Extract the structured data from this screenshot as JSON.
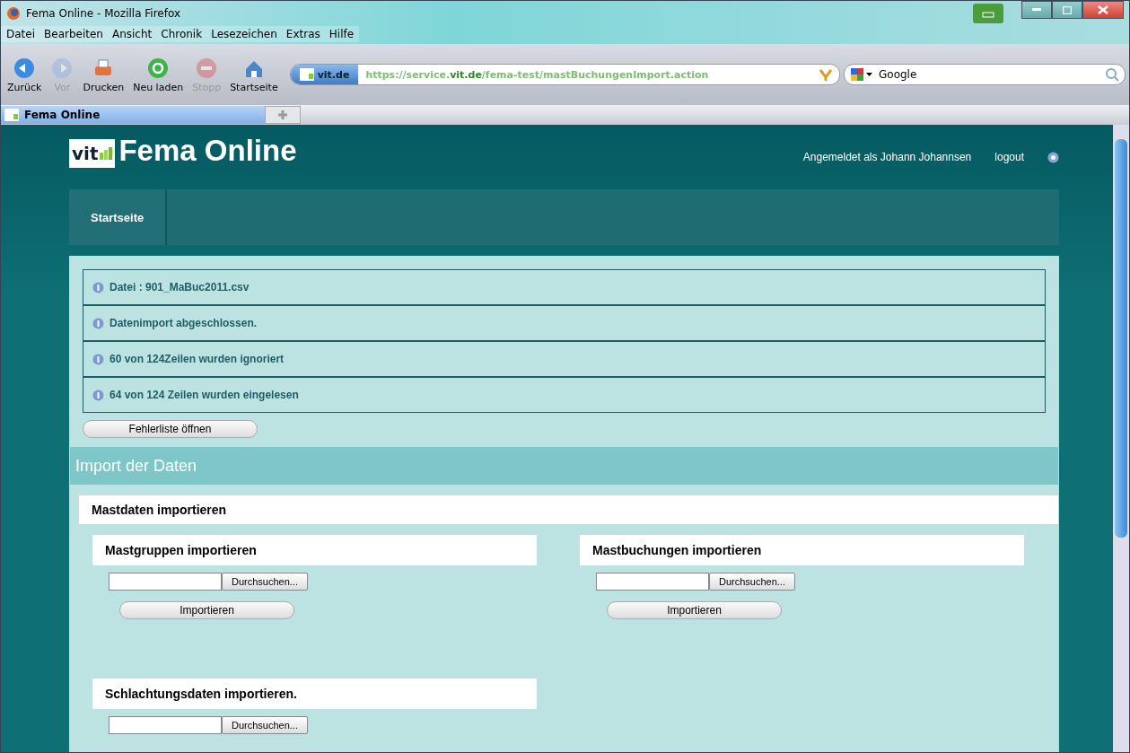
{
  "window": {
    "title": "Fema Online - Mozilla Firefox"
  },
  "menu": [
    "Datei",
    "Bearbeiten",
    "Ansicht",
    "Chronik",
    "Lesezeichen",
    "Extras",
    "Hilfe"
  ],
  "toolbar": [
    {
      "kind": "back",
      "label": "Zurück",
      "disabled": false
    },
    {
      "kind": "forward",
      "label": "Vor",
      "disabled": true
    },
    {
      "kind": "print",
      "label": "Drucken",
      "disabled": false
    },
    {
      "kind": "reload",
      "label": "Neu laden",
      "disabled": false
    },
    {
      "kind": "stop",
      "label": "Stopp",
      "disabled": true
    },
    {
      "kind": "home",
      "label": "Startseite",
      "disabled": false
    }
  ],
  "address": {
    "site": "vit.de",
    "url_prefix": "https://service.",
    "url_domain": "vit.de",
    "url_path": "/fema-test/mastBuchungenImport.action"
  },
  "search": {
    "engine": "Google"
  },
  "tabs": [
    {
      "label": "Fema Online",
      "selected": true
    }
  ],
  "page": {
    "brand": "vit",
    "title": "Fema Online",
    "user": "Angemeldet als Johann Johannsen",
    "logout": "logout",
    "nav": [
      {
        "label": "Startseite",
        "selected": true
      }
    ],
    "messages": [
      "Datei : 901_MaBuc2011.csv",
      "Datenimport abgeschlossen.",
      "60 von 124Zeilen wurden ignoriert",
      "64 von 124 Zeilen wurden eingelesen"
    ],
    "error_button": "Fehlerliste öffnen",
    "section_title": "Import der Daten",
    "subsection_title": "Mastdaten importieren",
    "imports": [
      {
        "title": "Mastgruppen importieren",
        "browse": "Durchsuchen...",
        "submit": "Importieren"
      },
      {
        "title": "Mastbuchungen importieren",
        "browse": "Durchsuchen...",
        "submit": "Importieren"
      },
      {
        "title": "Schlachtungsdaten importieren.",
        "browse": "Durchsuchen..."
      }
    ]
  }
}
